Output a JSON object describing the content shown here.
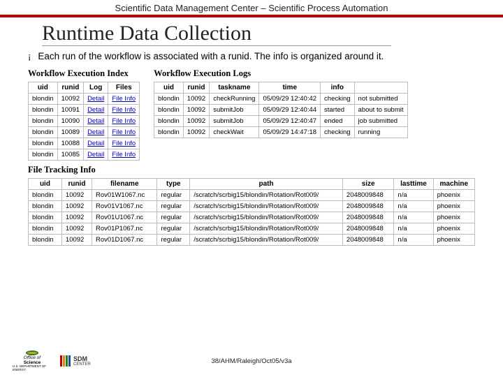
{
  "header": {
    "org": "Scientific Data Management Center – Scientific Process Automation"
  },
  "title": "Runtime Data Collection",
  "bullet": "Each run of the workflow is associated with a runid. The info is organized around it.",
  "index_table": {
    "title": "Workflow Execution Index",
    "headers": [
      "uid",
      "runid",
      "Log",
      "Files"
    ],
    "link_detail": "Detail",
    "link_file": "File Info",
    "rows": [
      {
        "uid": "blondin",
        "runid": "10092"
      },
      {
        "uid": "blondin",
        "runid": "10091"
      },
      {
        "uid": "blondin",
        "runid": "10090"
      },
      {
        "uid": "blondin",
        "runid": "10089"
      },
      {
        "uid": "blondin",
        "runid": "10088"
      },
      {
        "uid": "blondin",
        "runid": "10085"
      }
    ]
  },
  "logs_table": {
    "title": "Workflow Execution Logs",
    "headers": [
      "uid",
      "runid",
      "taskname",
      "time",
      "info",
      ""
    ],
    "rows": [
      {
        "uid": "blondin",
        "runid": "10092",
        "task": "checkRunning",
        "time": "05/09/29 12:40:42",
        "info": "checking",
        "extra": "not submitted"
      },
      {
        "uid": "blondin",
        "runid": "10092",
        "task": "submitJob",
        "time": "05/09/29 12:40:44",
        "info": "started",
        "extra": "about to submit"
      },
      {
        "uid": "blondin",
        "runid": "10092",
        "task": "submitJob",
        "time": "05/09/29 12:40:47",
        "info": "ended",
        "extra": "job submitted"
      },
      {
        "uid": "blondin",
        "runid": "10092",
        "task": "checkWait",
        "time": "05/09/29 14:47:18",
        "info": "checking",
        "extra": "running"
      }
    ]
  },
  "file_table": {
    "title": "File Tracking Info",
    "headers": [
      "uid",
      "runid",
      "filename",
      "type",
      "path",
      "size",
      "lasttime",
      "machine"
    ],
    "rows": [
      {
        "uid": "blondin",
        "runid": "10092",
        "fn": "Rov01W1067.nc",
        "type": "regular",
        "path": "/scratch/scrbig15/blondin/Rotation/Rot009/",
        "size": "2048009848",
        "lt": "n/a",
        "m": "phoenix"
      },
      {
        "uid": "blondin",
        "runid": "10092",
        "fn": "Rov01V1067.nc",
        "type": "regular",
        "path": "/scratch/scrbig15/blondin/Rotation/Rot009/",
        "size": "2048009848",
        "lt": "n/a",
        "m": "phoenix"
      },
      {
        "uid": "blondin",
        "runid": "10092",
        "fn": "Rov01U1067.nc",
        "type": "regular",
        "path": "/scratch/scrbig15/blondin/Rotation/Rot009/",
        "size": "2048009848",
        "lt": "n/a",
        "m": "phoenix"
      },
      {
        "uid": "blondin",
        "runid": "10092",
        "fn": "Rov01P1067.nc",
        "type": "regular",
        "path": "/scratch/scrbig15/blondin/Rotation/Rot009/",
        "size": "2048009848",
        "lt": "n/a",
        "m": "phoenix"
      },
      {
        "uid": "blondin",
        "runid": "10092",
        "fn": "Rov01D1067.nc",
        "type": "regular",
        "path": "/scratch/scrbig15/blondin/Rotation/Rot009/",
        "size": "2048009848",
        "lt": "n/a",
        "m": "phoenix"
      }
    ]
  },
  "footer": {
    "office": "Office of",
    "science": "Science",
    "dept": "U.S. DEPARTMENT OF ENERGY",
    "sdm": "SDM",
    "center": "CENTER",
    "pager": "38/AHM/Raleigh/Oct05/v3a"
  }
}
